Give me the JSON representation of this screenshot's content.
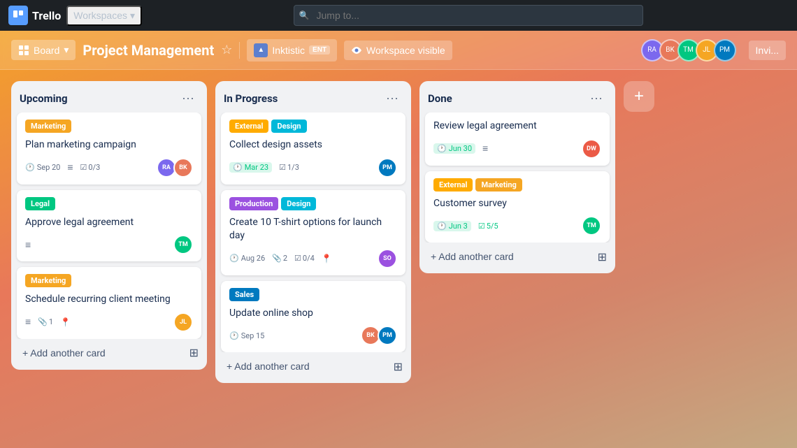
{
  "app": {
    "name": "Trello",
    "logo_text": "Trello"
  },
  "nav": {
    "workspaces_label": "Workspaces",
    "search_placeholder": "Jump to..."
  },
  "board_header": {
    "view_label": "Board",
    "title": "Project Management",
    "workspace_name": "Inktistic",
    "workspace_tier": "ENT",
    "visibility_label": "Workspace visible",
    "invite_label": "Invi..."
  },
  "columns": [
    {
      "id": "upcoming",
      "title": "Upcoming",
      "cards": [
        {
          "id": "c1",
          "labels": [
            {
              "text": "Marketing",
              "cls": "label-marketing"
            }
          ],
          "title": "Plan marketing campaign",
          "meta": [
            {
              "icon": "🕐",
              "text": "Sep 20"
            },
            {
              "icon": "≡",
              "text": ""
            },
            {
              "icon": "☑",
              "text": "0/3"
            }
          ],
          "assignees": [
            "av1",
            "av2"
          ]
        },
        {
          "id": "c2",
          "labels": [
            {
              "text": "Legal",
              "cls": "label-legal"
            }
          ],
          "title": "Approve legal agreement",
          "meta": [
            {
              "icon": "≡",
              "text": ""
            }
          ],
          "assignees": [
            "av3"
          ]
        },
        {
          "id": "c3",
          "labels": [
            {
              "text": "Marketing",
              "cls": "label-marketing"
            }
          ],
          "title": "Schedule recurring client meeting",
          "meta": [
            {
              "icon": "≡",
              "text": ""
            },
            {
              "icon": "📎",
              "text": "1"
            },
            {
              "icon": "📍",
              "text": ""
            }
          ],
          "assignees": [
            "av4"
          ]
        }
      ],
      "add_label": "+ Add another card"
    },
    {
      "id": "in-progress",
      "title": "In Progress",
      "cards": [
        {
          "id": "c4",
          "labels": [
            {
              "text": "External",
              "cls": "label-external"
            },
            {
              "text": "Design",
              "cls": "label-design"
            }
          ],
          "title": "Collect design assets",
          "meta": [
            {
              "icon": "🕐",
              "text": "Mar 23",
              "green": true
            },
            {
              "icon": "☑",
              "text": "1/3"
            }
          ],
          "assignees": [
            "av5"
          ]
        },
        {
          "id": "c5",
          "labels": [
            {
              "text": "Production",
              "cls": "label-production"
            },
            {
              "text": "Design",
              "cls": "label-design"
            }
          ],
          "title": "Create 10 T-shirt options for launch day",
          "meta": [
            {
              "icon": "🕐",
              "text": "Aug 26"
            },
            {
              "icon": "📎",
              "text": "2"
            },
            {
              "icon": "☑",
              "text": "0/4"
            },
            {
              "icon": "📍",
              "text": ""
            }
          ],
          "assignees": [
            "av6"
          ]
        },
        {
          "id": "c6",
          "labels": [
            {
              "text": "Sales",
              "cls": "label-sales"
            }
          ],
          "title": "Update online shop",
          "meta": [
            {
              "icon": "🕐",
              "text": "Sep 15"
            }
          ],
          "assignees": [
            "av2",
            "av5"
          ]
        }
      ],
      "add_label": "+ Add another card"
    },
    {
      "id": "done",
      "title": "Done",
      "cards": [
        {
          "id": "c7",
          "labels": [],
          "title": "Review legal agreement",
          "meta": [
            {
              "icon": "🕐",
              "text": "Jun 30",
              "green": true
            },
            {
              "icon": "≡",
              "text": ""
            }
          ],
          "assignees": [
            "av7"
          ]
        },
        {
          "id": "c8",
          "labels": [
            {
              "text": "External",
              "cls": "label-external"
            },
            {
              "text": "Marketing",
              "cls": "label-marketing"
            }
          ],
          "title": "Customer survey",
          "meta": [
            {
              "icon": "🕐",
              "text": "Jun 3",
              "green": true
            },
            {
              "icon": "☑",
              "text": "5/5",
              "green": true
            }
          ],
          "assignees": [
            "av3"
          ]
        }
      ],
      "add_label": "+ Add another card"
    }
  ],
  "add_list_label": "+"
}
